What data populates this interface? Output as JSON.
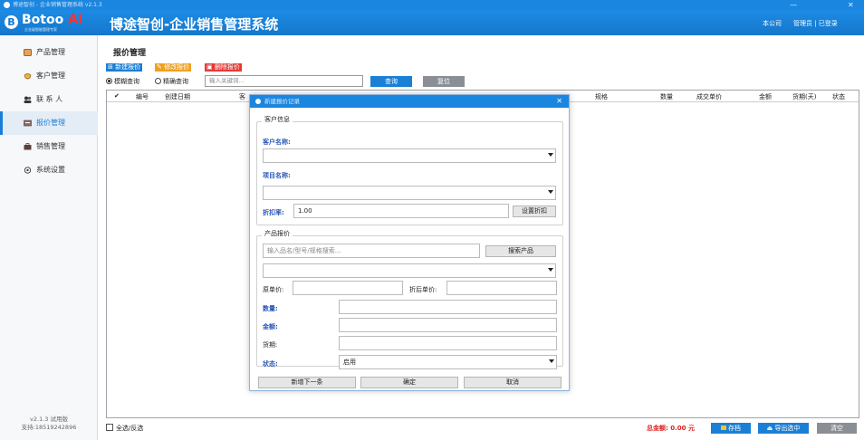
{
  "titlebar": {
    "text": "博途智创 - 企业销售管理系统 v2.1.3",
    "minimize": "—",
    "close": "✕"
  },
  "header": {
    "logo_letter": "B",
    "logo_text": "Botoo ",
    "logo_ai": "AI",
    "logo_sub": "企业级智能管理专家",
    "app_title": "博途智创-企业销售管理系统",
    "company": "本公司",
    "user": "管理员 | 已登录"
  },
  "sidebar": {
    "items": [
      {
        "label": "产品管理",
        "icon": "product-icon"
      },
      {
        "label": "客户管理",
        "icon": "customer-icon"
      },
      {
        "label": "联 系 人",
        "icon": "contact-icon"
      },
      {
        "label": "报价管理",
        "icon": "quote-icon"
      },
      {
        "label": "销售管理",
        "icon": "sales-icon"
      },
      {
        "label": "系统设置",
        "icon": "settings-icon"
      }
    ],
    "version": "v2.1.3 试用版",
    "support": "支持:18519242896"
  },
  "main": {
    "page_title": "报价管理",
    "toolbar": {
      "new": "新建报价",
      "edit": "修改报价",
      "delete": "删除报价"
    },
    "search": {
      "fuzzy": "模糊查询",
      "exact": "精确查询",
      "placeholder": "输入关键词...",
      "query": "查询",
      "reset": "复位"
    },
    "columns": [
      "✔",
      "编号",
      "创建日期",
      "客",
      "规格",
      "数量",
      "成交单价",
      "金额",
      "货期(天)",
      "状态"
    ],
    "select_all": "全选/反选",
    "total_label": "总金额: 0.00 元",
    "save": "存档",
    "export": "导出选中",
    "clear": "清空"
  },
  "modal": {
    "title": "新建报价记录",
    "close": "✕",
    "customer_group": "客户信息",
    "customer_name_label": "客户名称:",
    "project_name_label": "项目名称:",
    "discount_label": "折扣率:",
    "discount_value": "1.00",
    "set_discount": "设置折扣",
    "product_group": "产品报价",
    "product_search_placeholder": "输入品名/型号/规格搜索...",
    "search_product": "搜索产品",
    "orig_price_label": "原单价:",
    "disc_price_label": "折后单价:",
    "qty_label": "数量:",
    "amount_label": "金额:",
    "delivery_label": "货期:",
    "status_label": "状态:",
    "status_value": "启用",
    "add_next": "新增下一条",
    "confirm": "确定",
    "cancel": "取消"
  },
  "colors": {
    "primary": "#1b86df",
    "new_btn": "#1b7fd6",
    "edit_btn": "#f0a020",
    "delete_btn": "#e53935",
    "total": "#e02020"
  }
}
